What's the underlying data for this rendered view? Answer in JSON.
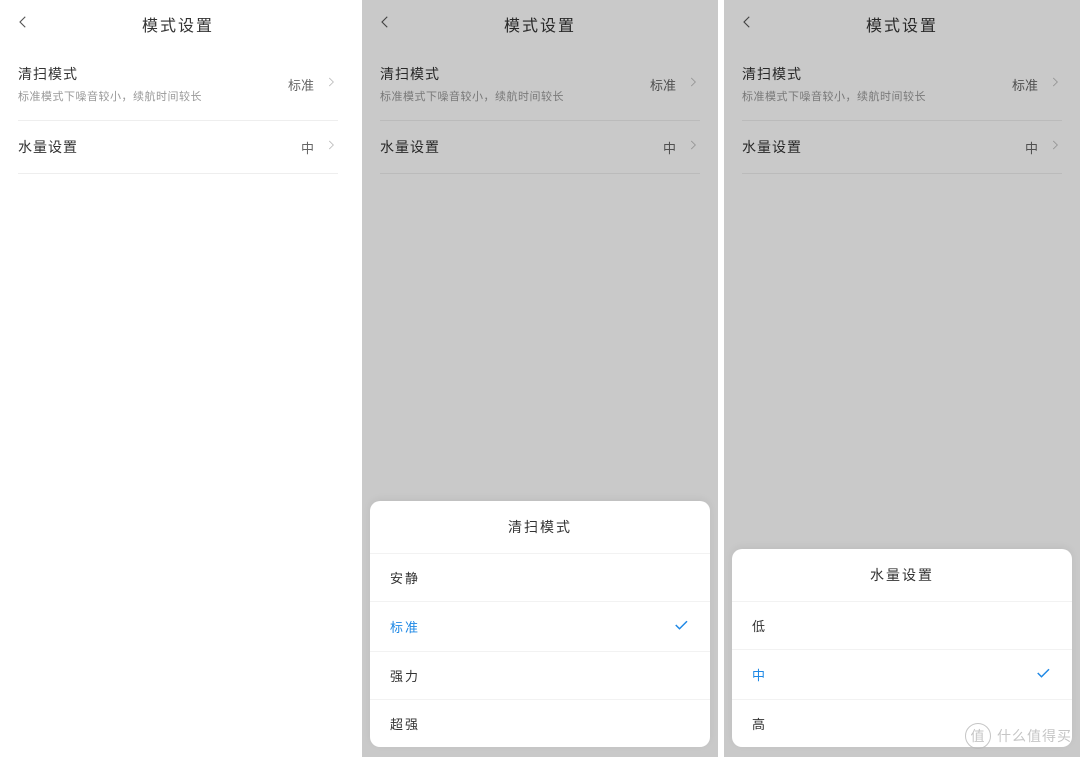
{
  "header": {
    "title": "模式设置"
  },
  "rows": {
    "clean": {
      "label": "清扫模式",
      "sub": "标准模式下噪音较小，续航时间较长",
      "value": "标准"
    },
    "water": {
      "label": "水量设置",
      "value": "中"
    }
  },
  "sheet_clean": {
    "title": "清扫模式",
    "opts": [
      "安静",
      "标准",
      "强力",
      "超强"
    ],
    "selected": "标准"
  },
  "sheet_water": {
    "title": "水量设置",
    "opts": [
      "低",
      "中",
      "高"
    ],
    "selected": "中"
  },
  "watermark": {
    "badge": "值",
    "text": "什么值得买"
  }
}
